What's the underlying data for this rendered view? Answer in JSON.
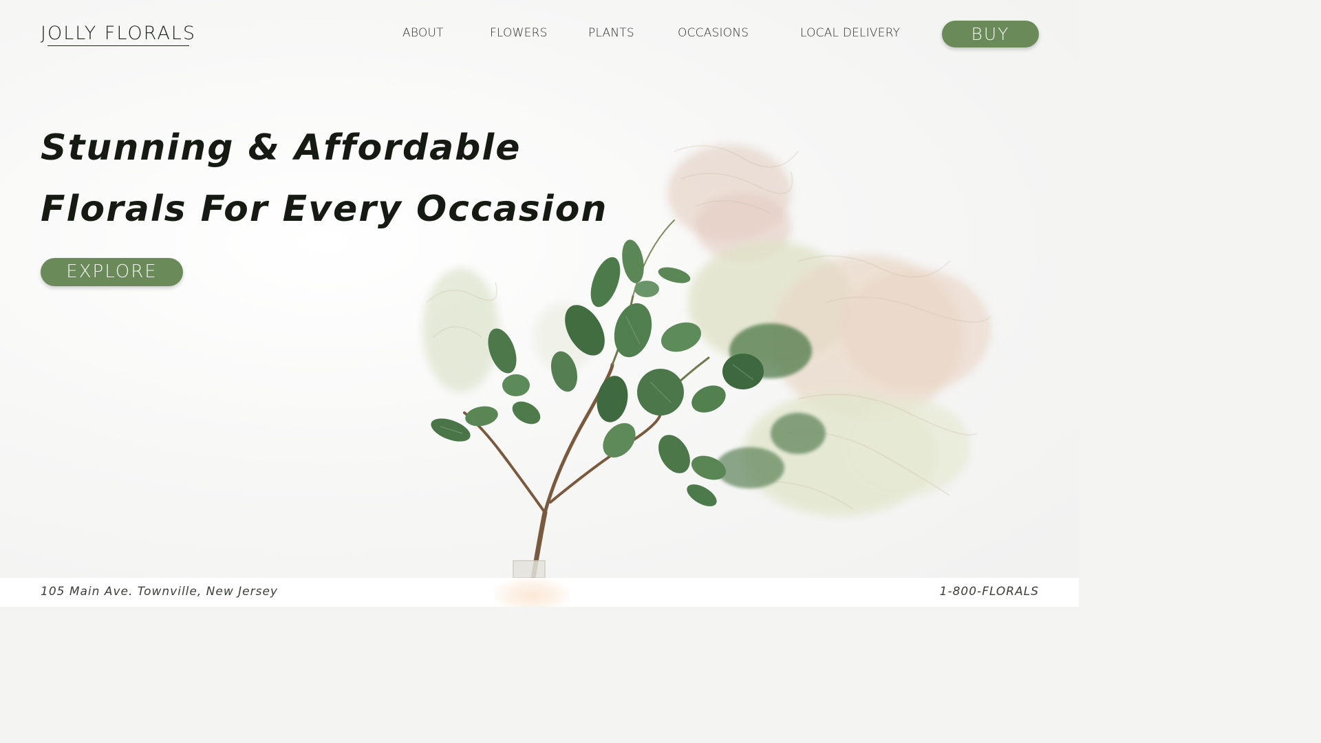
{
  "brand": {
    "logo_text": "JOLLY FLORALS"
  },
  "nav": {
    "items": [
      {
        "label": "ABOUT"
      },
      {
        "label": "FLOWERS"
      },
      {
        "label": "PLANTS"
      },
      {
        "label": "OCCASIONS"
      },
      {
        "label": "LOCAL DELIVERY"
      }
    ],
    "buy_label": "BUY"
  },
  "hero": {
    "headline_line1": "Stunning & Affordable",
    "headline_line2": "Florals For Every Occasion",
    "explore_label": "EXPLORE",
    "image_icon": "smoke-bush-branch-illustration"
  },
  "footer": {
    "address": "105 Main Ave. Townville, New Jersey",
    "phone": "1-800-FLORALS"
  },
  "colors": {
    "accent": "#6a8a5a",
    "text": "#1d2218",
    "background": "#f4f4f3"
  }
}
